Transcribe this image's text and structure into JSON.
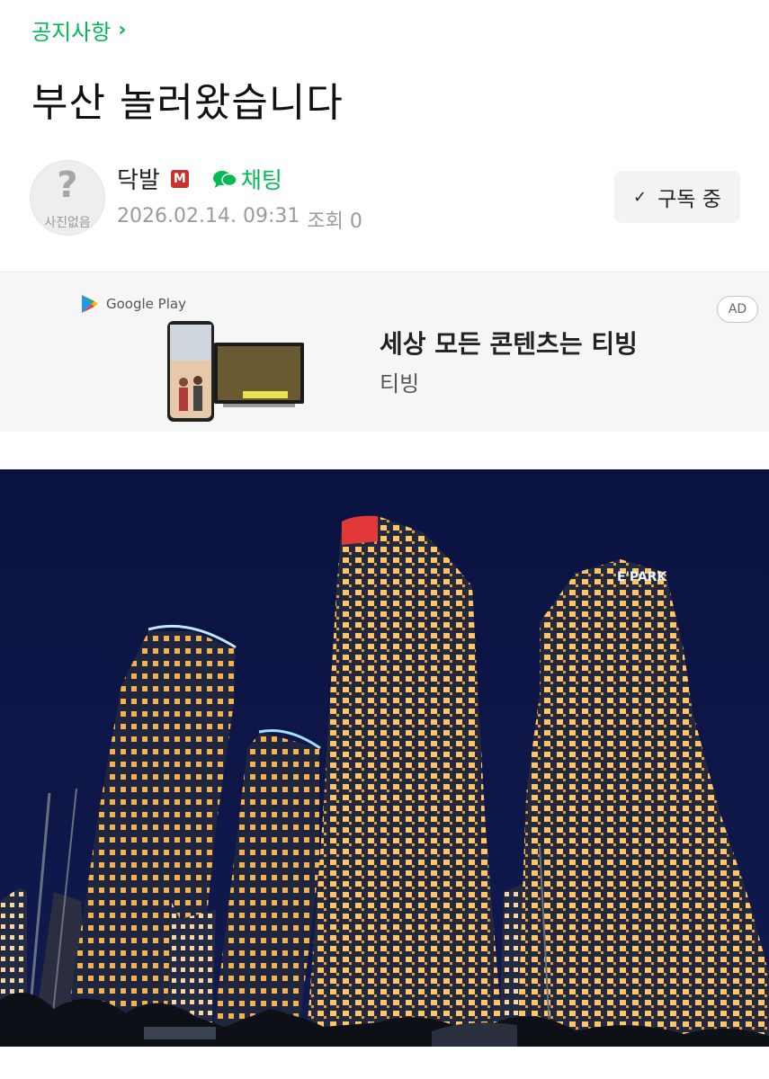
{
  "breadcrumb": {
    "label": "공지사항"
  },
  "post": {
    "title": "부산 놀러왔습니다"
  },
  "author": {
    "avatar_text": "사진없음",
    "name": "닥발",
    "grade_badge": "M",
    "chat_label": "채팅",
    "date": "2026.02.14. 09:31",
    "views": "조회 0"
  },
  "subscribe": {
    "label": "구독 중"
  },
  "ad": {
    "store_label": "Google Play",
    "badge": "AD",
    "headline": "세상 모든 콘텐츠는 티빙",
    "subtitle": "티빙"
  },
  "photo": {
    "sign": "E'PARK"
  },
  "colors": {
    "accent_green": "#03b955",
    "badge_red": "#c9332c",
    "sky": "#0b1444"
  }
}
